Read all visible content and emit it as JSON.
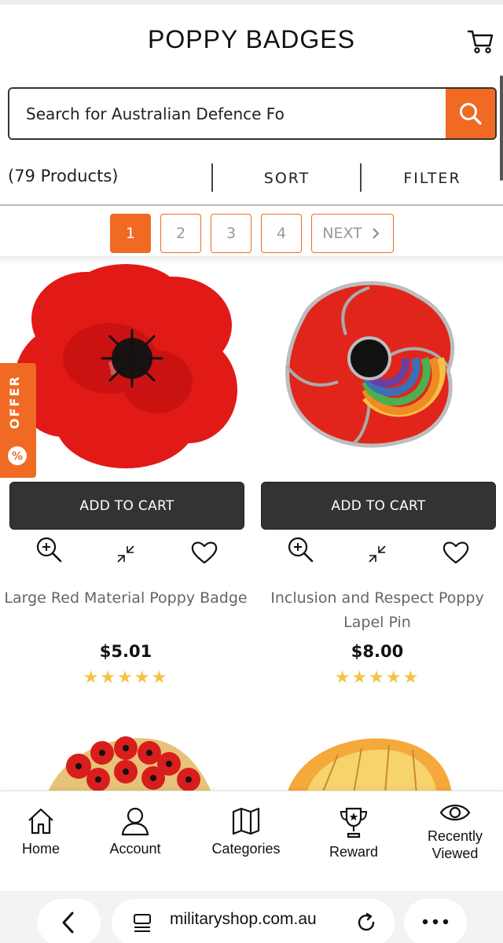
{
  "header": {
    "title": "POPPY BADGES",
    "cart_icon": "cart-icon"
  },
  "search": {
    "value": "Search for Australian Defence Fo",
    "button_icon": "search-icon"
  },
  "toolbar": {
    "count": "(79 Products)",
    "sort": "SORT",
    "filter": "FILTER"
  },
  "pagination": {
    "pages": [
      "1",
      "2",
      "3",
      "4"
    ],
    "active_page": "1",
    "next": "NEXT"
  },
  "offer_tab": {
    "label": "OFFER",
    "icon": "percent-icon"
  },
  "products": [
    {
      "name": "Large Red Material Poppy Badge",
      "price": "$5.01",
      "rating": 5,
      "stars": "★★★★★",
      "add_to_cart": "ADD TO CART"
    },
    {
      "name": "Inclusion and Respect Poppy Lapel Pin",
      "price": "$8.00",
      "rating": 5,
      "stars": "★★★★★",
      "add_to_cart": "ADD TO CART"
    }
  ],
  "bottom_nav": [
    {
      "label": "Home",
      "icon": "home-icon"
    },
    {
      "label": "Account",
      "icon": "user-icon"
    },
    {
      "label": "Categories",
      "icon": "map-icon"
    },
    {
      "label": "Reward",
      "icon": "trophy-icon"
    },
    {
      "label": "Recently Viewed",
      "line1": "Recently",
      "line2": "Viewed",
      "icon": "eye-icon"
    }
  ],
  "browser": {
    "url": "militaryshop.com.au"
  },
  "colors": {
    "accent": "#f06a23",
    "button_dark": "#333333",
    "star": "#f5c242"
  }
}
